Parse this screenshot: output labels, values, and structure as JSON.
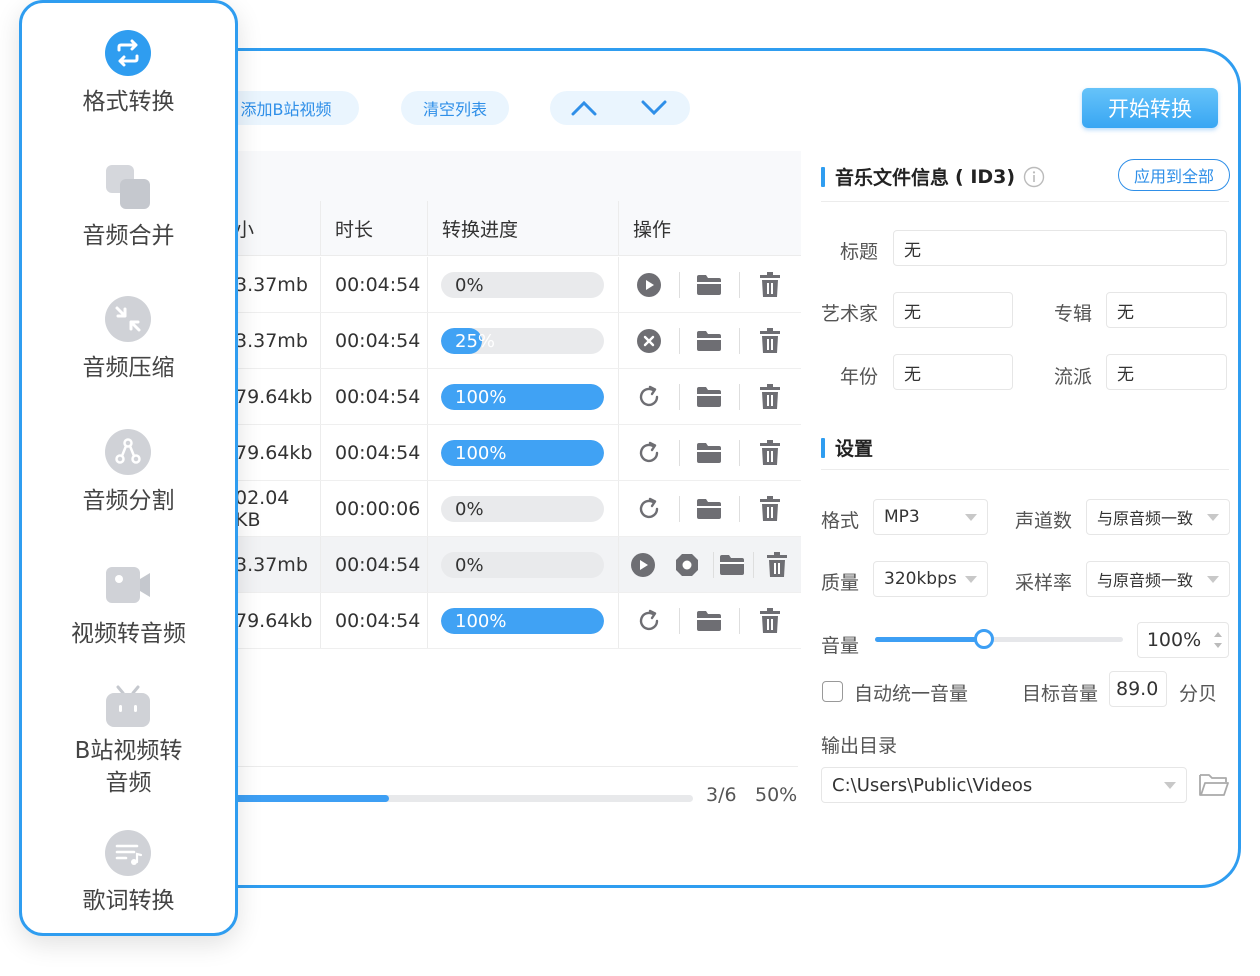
{
  "sidebar": {
    "items": [
      {
        "label": "格式转换",
        "active": true
      },
      {
        "label": "音频合并"
      },
      {
        "label": "音频压缩"
      },
      {
        "label": "音频分割"
      },
      {
        "label": "视频转音频"
      },
      {
        "label": "B站视频转",
        "label2": "音频"
      },
      {
        "label": "歌词转换"
      }
    ]
  },
  "toolbar": {
    "add_bilibili": "添加B站视频",
    "clear_list": "清空列表",
    "start_convert": "开始转换"
  },
  "table": {
    "headers": [
      "小",
      "时长",
      "转换进度",
      "操作"
    ],
    "rows": [
      {
        "size": "3.37mb",
        "duration": "00:04:54",
        "progress": 0,
        "progress_text": "0%",
        "state": "play"
      },
      {
        "size": "3.37mb",
        "duration": "00:04:54",
        "progress": 25,
        "progress_text": "25%",
        "state": "cancel"
      },
      {
        "size": "79.64kb",
        "duration": "00:04:54",
        "progress": 100,
        "progress_text": "100%",
        "state": "redo"
      },
      {
        "size": "79.64kb",
        "duration": "00:04:54",
        "progress": 100,
        "progress_text": "100%",
        "state": "redo"
      },
      {
        "size": "02.04 KB",
        "duration": "00:00:06",
        "progress": 0,
        "progress_text": "0%",
        "state": "redo"
      },
      {
        "size": "3.37mb",
        "duration": "00:04:54",
        "progress": 0,
        "progress_text": "0%",
        "state": "play-stop"
      },
      {
        "size": "79.64kb",
        "duration": "00:04:54",
        "progress": 100,
        "progress_text": "100%",
        "state": "redo"
      }
    ]
  },
  "footer": {
    "overall_progress": 0.34,
    "count": "3/6",
    "percent": "50%"
  },
  "id3": {
    "title": "音乐文件信息",
    "title_suffix": "( ID3)",
    "apply_all": "应用到全部",
    "fields": {
      "title_label": "标题",
      "title_value": "无",
      "artist_label": "艺术家",
      "artist_value": "无",
      "album_label": "专辑",
      "album_value": "无",
      "year_label": "年份",
      "year_value": "无",
      "genre_label": "流派",
      "genre_value": "无"
    }
  },
  "settings": {
    "title": "设置",
    "format_label": "格式",
    "format_value": "MP3",
    "channels_label": "声道数",
    "channels_value": "与原音频一致",
    "quality_label": "质量",
    "quality_value": "320kbps",
    "samplerate_label": "采样率",
    "samplerate_value": "与原音频一致",
    "volume_label": "音量",
    "volume_value": "100%",
    "volume_level": 0.44,
    "auto_volume_label": "自动统一音量",
    "target_volume_label": "目标音量",
    "target_volume_value": "89.0",
    "target_volume_unit": "分贝",
    "output_label": "输出目录",
    "output_value": "C:\\Users\\Public\\Videos"
  },
  "colors": {
    "accent": "#2f9df0",
    "progress": "#40a2f4",
    "icon_gray": "#c9cbd1"
  }
}
